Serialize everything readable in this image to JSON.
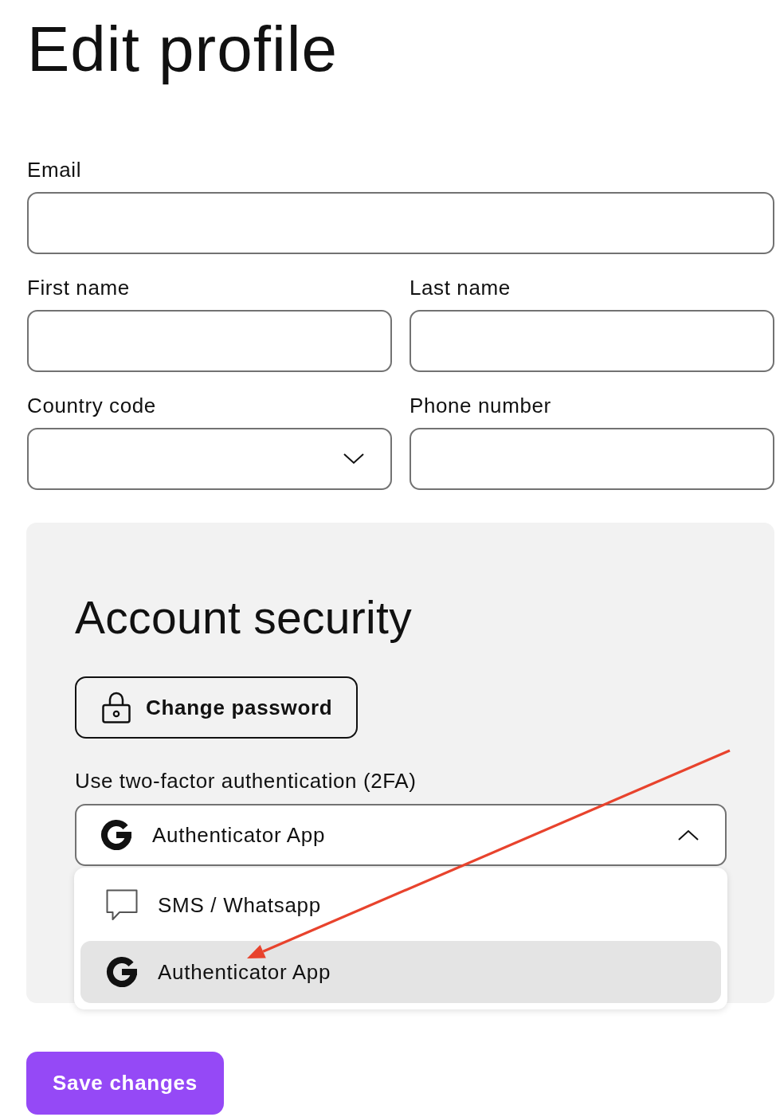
{
  "title": "Edit profile",
  "form_rows": [
    [
      {
        "label": "Email",
        "kind": "text"
      }
    ],
    [
      {
        "label": "First name",
        "kind": "text"
      },
      {
        "label": "Last name",
        "kind": "text"
      }
    ],
    [
      {
        "label": "Country code",
        "kind": "select"
      },
      {
        "label": "Phone number",
        "kind": "text"
      }
    ]
  ],
  "account_security": {
    "title": "Account security",
    "change_password_button": "Change password",
    "two_factor": {
      "label": "Use two-factor authentication (2FA)",
      "value": {
        "label": "Authenticator App",
        "kind": "authenticator"
      },
      "expanded": true,
      "options": [
        {
          "label": "SMS / Whatsapp",
          "kind": "sms",
          "selected": false
        },
        {
          "label": "Authenticator App",
          "kind": "authenticator",
          "selected": true
        }
      ]
    }
  },
  "save_button": "Save changes",
  "annotations": [
    {
      "kind": "arrow"
    }
  ]
}
